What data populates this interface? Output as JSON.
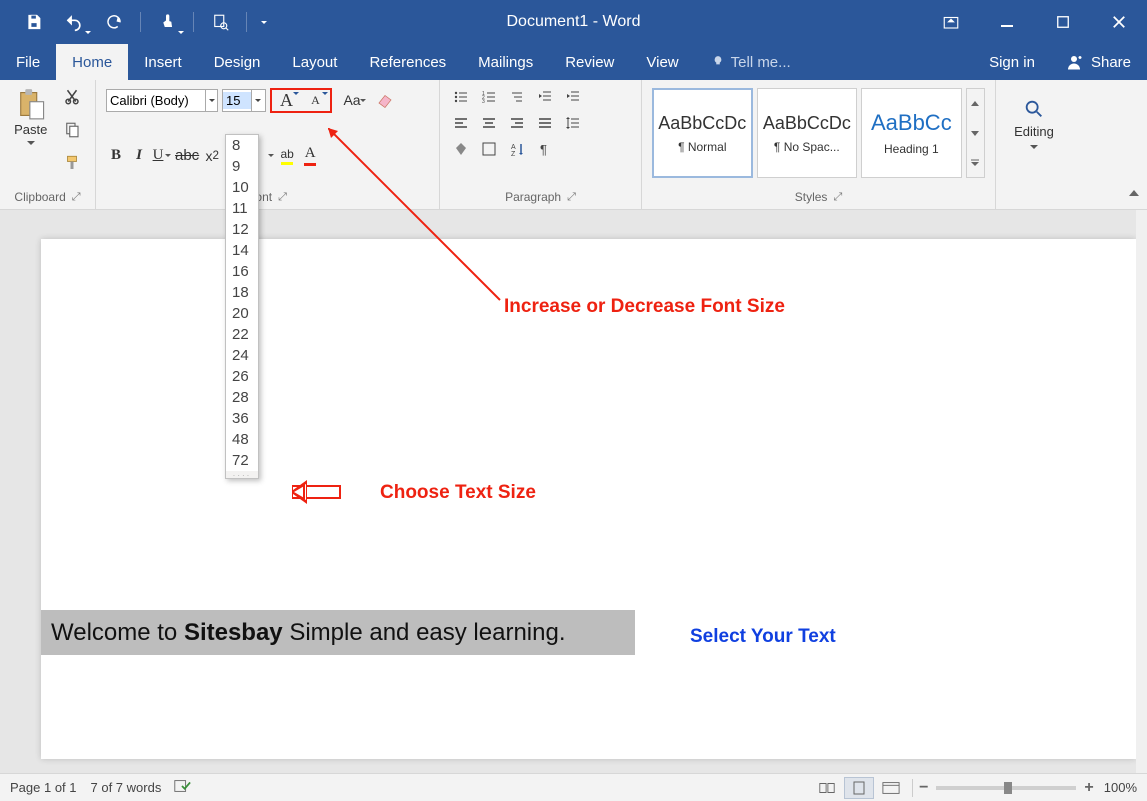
{
  "title": "Document1 - Word",
  "tabs": [
    "File",
    "Home",
    "Insert",
    "Design",
    "Layout",
    "References",
    "Mailings",
    "Review",
    "View"
  ],
  "active_tab": "Home",
  "tell_me": "Tell me...",
  "signin": "Sign in",
  "share": "Share",
  "ribbon": {
    "clipboard": {
      "label": "Clipboard",
      "paste": "Paste"
    },
    "font": {
      "label": "Font",
      "name": "Calibri (Body)",
      "size": "15",
      "sizes": [
        "8",
        "9",
        "10",
        "11",
        "12",
        "14",
        "16",
        "18",
        "20",
        "22",
        "24",
        "26",
        "28",
        "36",
        "48",
        "72"
      ]
    },
    "paragraph": {
      "label": "Paragraph"
    },
    "styles": {
      "label": "Styles",
      "items": [
        {
          "preview": "AaBbCcDc",
          "name": "¶ Normal"
        },
        {
          "preview": "AaBbCcDc",
          "name": "¶ No Spac..."
        },
        {
          "preview": "AaBbCc",
          "name": "Heading 1"
        }
      ]
    },
    "editing": {
      "label": "Editing"
    }
  },
  "annotations": {
    "grow_shrink": "Increase or Decrease Font Size",
    "choose_size": "Choose Text Size",
    "select_text": "Select Your Text"
  },
  "document": {
    "text_pre": "Welcome to ",
    "text_bold": "Sitesbay",
    "text_post": " Simple and easy learning."
  },
  "status": {
    "page": "Page 1 of 1",
    "words": "7 of 7 words",
    "zoom": "100%"
  }
}
